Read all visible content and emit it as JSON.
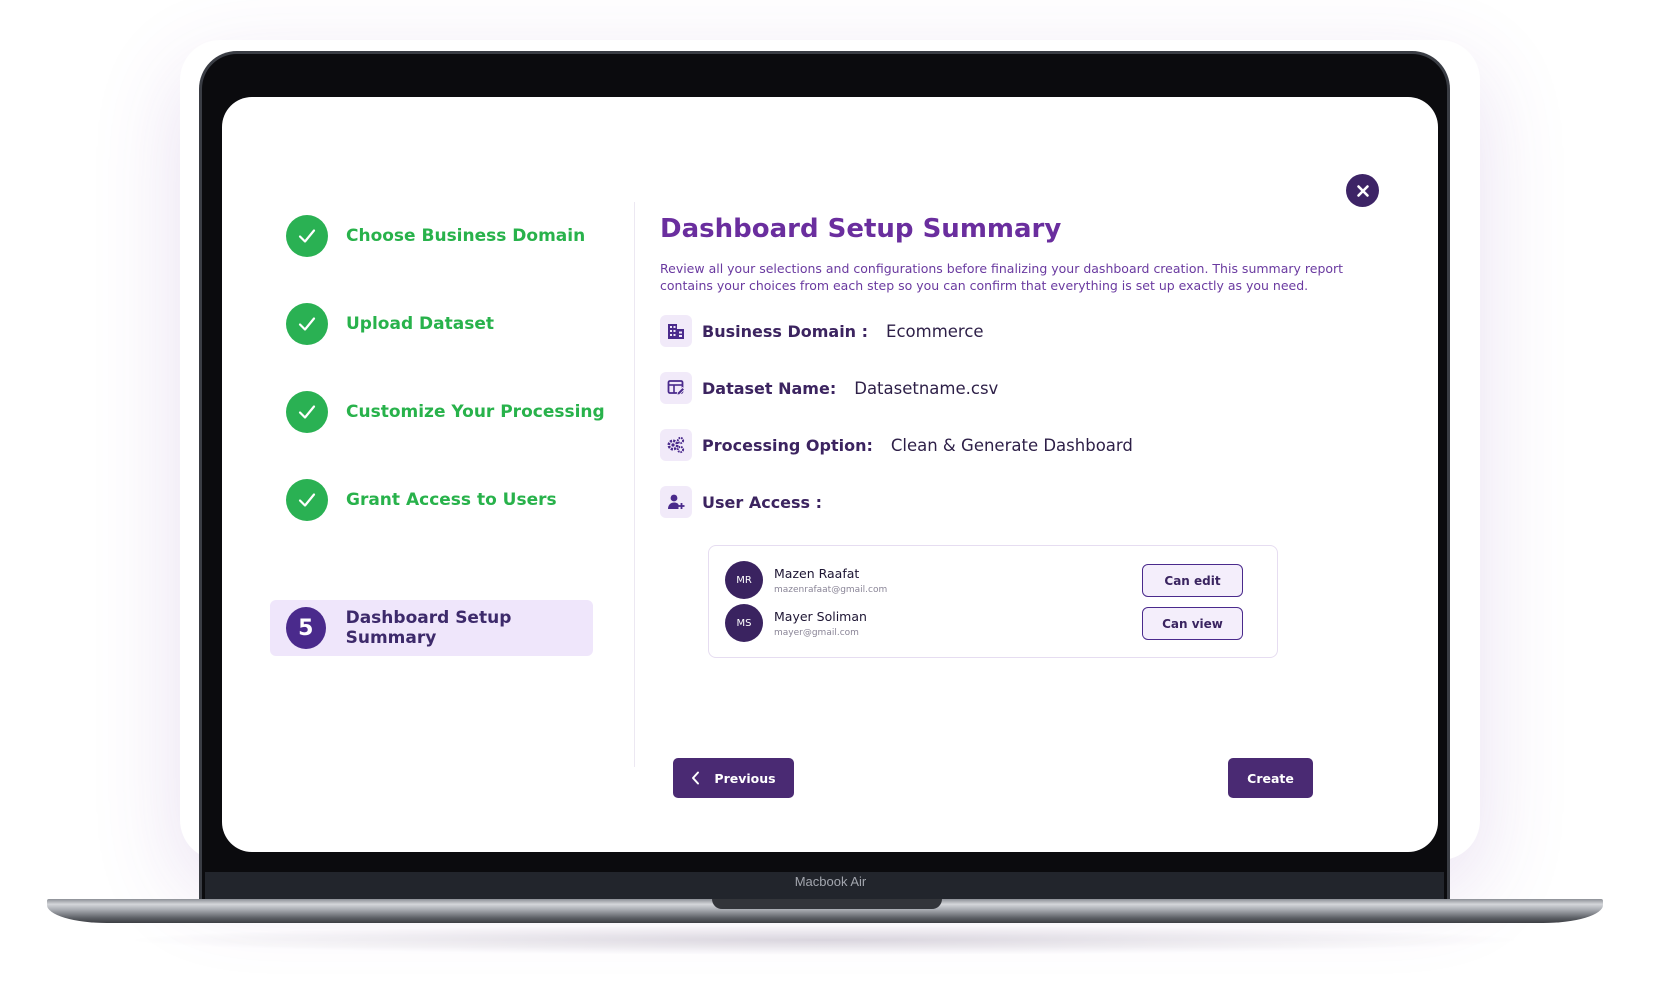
{
  "device": {
    "label": "Macbook Air"
  },
  "steps": [
    {
      "label": "Choose Business Domain",
      "status": "complete"
    },
    {
      "label": "Upload Dataset",
      "status": "complete"
    },
    {
      "label": "Customize Your Processing",
      "status": "complete"
    },
    {
      "label": "Grant Access to Users",
      "status": "complete"
    },
    {
      "number": "5",
      "label": "Dashboard Setup Summary",
      "status": "active"
    }
  ],
  "summary": {
    "title": "Dashboard Setup Summary",
    "description": "Review all your selections and configurations before finalizing your dashboard creation. This summary report contains your choices from each step so you can confirm that everything is set up exactly as you need.",
    "rows": [
      {
        "icon": "building-icon",
        "label": "Business Domain :",
        "value": "Ecommerce"
      },
      {
        "icon": "dataset-edit-icon",
        "label": "Dataset Name:",
        "value": "Datasetname.csv"
      },
      {
        "icon": "gears-icon",
        "label": "Processing Option:",
        "value": "Clean & Generate Dashboard"
      },
      {
        "icon": "user-add-icon",
        "label": "User Access :",
        "value": ""
      }
    ],
    "users": [
      {
        "initials": "MR",
        "name": "Mazen Raafat",
        "email": "mazenrafaat@gmail.com",
        "permission": "Can edit"
      },
      {
        "initials": "MS",
        "name": "Mayer Soliman",
        "email": "mayer@gmail.com",
        "permission": "Can view"
      }
    ]
  },
  "buttons": {
    "previous": "Previous",
    "create": "Create"
  },
  "colors": {
    "accent": "#4a2a73",
    "success": "#2ab153",
    "title": "#6a2e9e"
  }
}
